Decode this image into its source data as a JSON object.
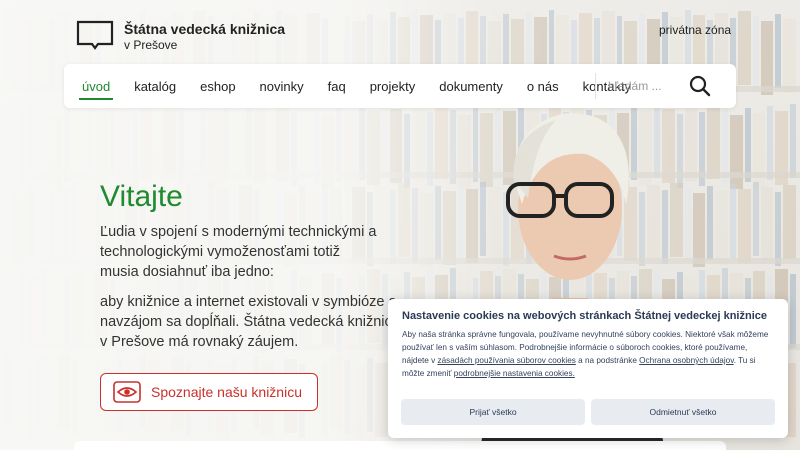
{
  "header": {
    "logo_title": "Štátna vedecká knižnica",
    "logo_subtitle": "v Prešove",
    "private_zone": "privátna zóna"
  },
  "nav": {
    "items": [
      {
        "label": "úvod",
        "active": true
      },
      {
        "label": "katalóg"
      },
      {
        "label": "eshop"
      },
      {
        "label": "novinky"
      },
      {
        "label": "faq"
      },
      {
        "label": "projekty"
      },
      {
        "label": "dokumenty"
      },
      {
        "label": "o nás"
      },
      {
        "label": "kontakty"
      }
    ],
    "search_placeholder": "hľadám ..."
  },
  "hero": {
    "title": "Vitajte",
    "paragraph1": "Ľudia v spojení s modernými technickými a technologickými vymoženosťami totiž musia dosiahnuť iba jedno:",
    "paragraph2": "aby knižnice a internet existovali v symbióze a navzájom sa dopĺňali. Štátna vedecká knižnica v Prešove má rovnaký záujem.",
    "cta_label": "Spoznajte našu knižnicu"
  },
  "cookie": {
    "title": "Nastavenie cookies na webových stránkach Štátnej vedeckej knižnice",
    "text_part1": "Aby naša stránka správne fungovala, používame nevyhnutné súbory cookies. Niektoré však môžeme používať len s vaším súhlasom. Podrobnejšie informácie o súboroch cookies, ktoré používame, nájdete v ",
    "link1": "zásadách používania súborov cookies",
    "text_part2": " a na podstránke ",
    "link2": "Ochrana osobných údajov",
    "text_part3": ". Tu si môžte zmeniť ",
    "link3": "podrobnejšie nastavenia cookies.",
    "accept": "Prijať všetko",
    "reject": "Odmietnuť všetko"
  },
  "colors": {
    "accent_green": "#1f8a2e",
    "cta_red": "#c9302c",
    "cookie_text": "#34425c"
  },
  "icons": {
    "logo": "open-book-icon",
    "search": "search-icon",
    "cta": "eye-icon"
  }
}
